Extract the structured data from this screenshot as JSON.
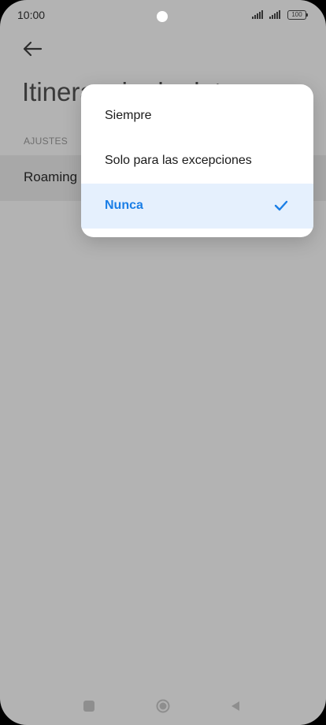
{
  "status_bar": {
    "time": "10:00",
    "battery": "100",
    "icons": [
      "signal-icon",
      "signal-icon",
      "battery-icon"
    ]
  },
  "header": {
    "back_icon": "arrow-left-icon",
    "title": "Itinerancia de datos"
  },
  "settings": {
    "section_label": "AJUSTES",
    "row_label": "Roaming"
  },
  "popup": {
    "options": [
      {
        "label": "Siempre",
        "selected": false
      },
      {
        "label": "Solo para las excepciones",
        "selected": false
      },
      {
        "label": "Nunca",
        "selected": true
      }
    ],
    "check_icon": "check-icon",
    "accent_color": "#1a7ee6",
    "selected_bg": "#e5f0fd"
  },
  "nav_bar": {
    "icons": [
      "recent-apps-icon",
      "home-icon",
      "back-icon"
    ]
  }
}
